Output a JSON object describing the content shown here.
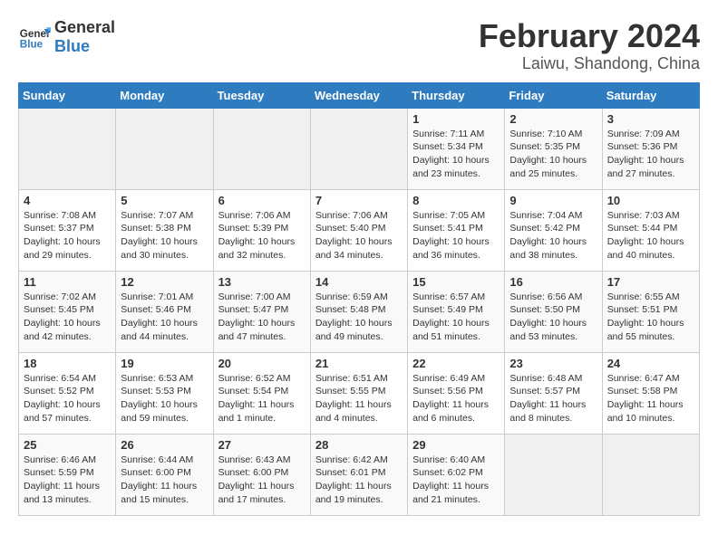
{
  "header": {
    "logo_text_general": "General",
    "logo_text_blue": "Blue",
    "title": "February 2024",
    "subtitle": "Laiwu, Shandong, China"
  },
  "weekdays": [
    "Sunday",
    "Monday",
    "Tuesday",
    "Wednesday",
    "Thursday",
    "Friday",
    "Saturday"
  ],
  "weeks": [
    [
      {
        "day": "",
        "info": ""
      },
      {
        "day": "",
        "info": ""
      },
      {
        "day": "",
        "info": ""
      },
      {
        "day": "",
        "info": ""
      },
      {
        "day": "1",
        "info": "Sunrise: 7:11 AM\nSunset: 5:34 PM\nDaylight: 10 hours\nand 23 minutes."
      },
      {
        "day": "2",
        "info": "Sunrise: 7:10 AM\nSunset: 5:35 PM\nDaylight: 10 hours\nand 25 minutes."
      },
      {
        "day": "3",
        "info": "Sunrise: 7:09 AM\nSunset: 5:36 PM\nDaylight: 10 hours\nand 27 minutes."
      }
    ],
    [
      {
        "day": "4",
        "info": "Sunrise: 7:08 AM\nSunset: 5:37 PM\nDaylight: 10 hours\nand 29 minutes."
      },
      {
        "day": "5",
        "info": "Sunrise: 7:07 AM\nSunset: 5:38 PM\nDaylight: 10 hours\nand 30 minutes."
      },
      {
        "day": "6",
        "info": "Sunrise: 7:06 AM\nSunset: 5:39 PM\nDaylight: 10 hours\nand 32 minutes."
      },
      {
        "day": "7",
        "info": "Sunrise: 7:06 AM\nSunset: 5:40 PM\nDaylight: 10 hours\nand 34 minutes."
      },
      {
        "day": "8",
        "info": "Sunrise: 7:05 AM\nSunset: 5:41 PM\nDaylight: 10 hours\nand 36 minutes."
      },
      {
        "day": "9",
        "info": "Sunrise: 7:04 AM\nSunset: 5:42 PM\nDaylight: 10 hours\nand 38 minutes."
      },
      {
        "day": "10",
        "info": "Sunrise: 7:03 AM\nSunset: 5:44 PM\nDaylight: 10 hours\nand 40 minutes."
      }
    ],
    [
      {
        "day": "11",
        "info": "Sunrise: 7:02 AM\nSunset: 5:45 PM\nDaylight: 10 hours\nand 42 minutes."
      },
      {
        "day": "12",
        "info": "Sunrise: 7:01 AM\nSunset: 5:46 PM\nDaylight: 10 hours\nand 44 minutes."
      },
      {
        "day": "13",
        "info": "Sunrise: 7:00 AM\nSunset: 5:47 PM\nDaylight: 10 hours\nand 47 minutes."
      },
      {
        "day": "14",
        "info": "Sunrise: 6:59 AM\nSunset: 5:48 PM\nDaylight: 10 hours\nand 49 minutes."
      },
      {
        "day": "15",
        "info": "Sunrise: 6:57 AM\nSunset: 5:49 PM\nDaylight: 10 hours\nand 51 minutes."
      },
      {
        "day": "16",
        "info": "Sunrise: 6:56 AM\nSunset: 5:50 PM\nDaylight: 10 hours\nand 53 minutes."
      },
      {
        "day": "17",
        "info": "Sunrise: 6:55 AM\nSunset: 5:51 PM\nDaylight: 10 hours\nand 55 minutes."
      }
    ],
    [
      {
        "day": "18",
        "info": "Sunrise: 6:54 AM\nSunset: 5:52 PM\nDaylight: 10 hours\nand 57 minutes."
      },
      {
        "day": "19",
        "info": "Sunrise: 6:53 AM\nSunset: 5:53 PM\nDaylight: 10 hours\nand 59 minutes."
      },
      {
        "day": "20",
        "info": "Sunrise: 6:52 AM\nSunset: 5:54 PM\nDaylight: 11 hours\nand 1 minute."
      },
      {
        "day": "21",
        "info": "Sunrise: 6:51 AM\nSunset: 5:55 PM\nDaylight: 11 hours\nand 4 minutes."
      },
      {
        "day": "22",
        "info": "Sunrise: 6:49 AM\nSunset: 5:56 PM\nDaylight: 11 hours\nand 6 minutes."
      },
      {
        "day": "23",
        "info": "Sunrise: 6:48 AM\nSunset: 5:57 PM\nDaylight: 11 hours\nand 8 minutes."
      },
      {
        "day": "24",
        "info": "Sunrise: 6:47 AM\nSunset: 5:58 PM\nDaylight: 11 hours\nand 10 minutes."
      }
    ],
    [
      {
        "day": "25",
        "info": "Sunrise: 6:46 AM\nSunset: 5:59 PM\nDaylight: 11 hours\nand 13 minutes."
      },
      {
        "day": "26",
        "info": "Sunrise: 6:44 AM\nSunset: 6:00 PM\nDaylight: 11 hours\nand 15 minutes."
      },
      {
        "day": "27",
        "info": "Sunrise: 6:43 AM\nSunset: 6:00 PM\nDaylight: 11 hours\nand 17 minutes."
      },
      {
        "day": "28",
        "info": "Sunrise: 6:42 AM\nSunset: 6:01 PM\nDaylight: 11 hours\nand 19 minutes."
      },
      {
        "day": "29",
        "info": "Sunrise: 6:40 AM\nSunset: 6:02 PM\nDaylight: 11 hours\nand 21 minutes."
      },
      {
        "day": "",
        "info": ""
      },
      {
        "day": "",
        "info": ""
      }
    ]
  ]
}
